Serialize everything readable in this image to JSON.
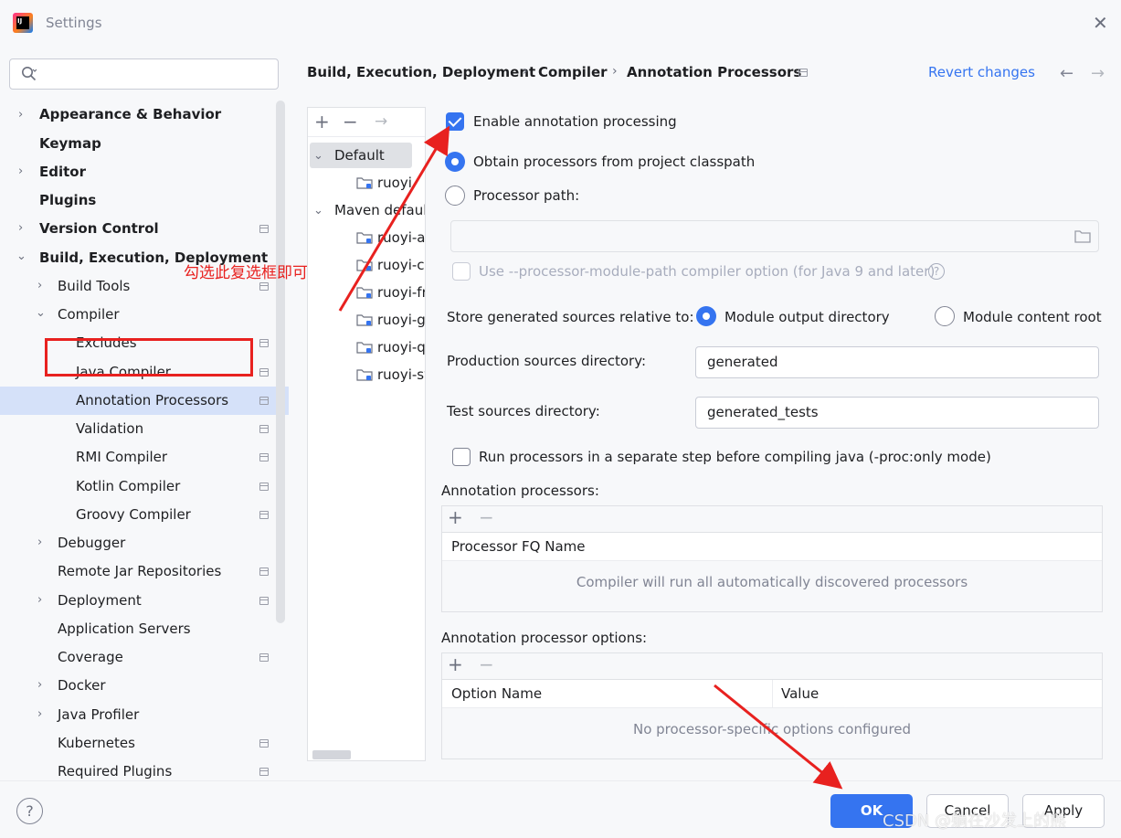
{
  "window": {
    "title": "Settings",
    "logo_text": "IJ"
  },
  "sidebar": {
    "search_placeholder": "",
    "items": [
      {
        "label": "Appearance & Behavior"
      },
      {
        "label": "Keymap"
      },
      {
        "label": "Editor"
      },
      {
        "label": "Plugins"
      },
      {
        "label": "Version Control"
      },
      {
        "label": "Build, Execution, Deployment"
      },
      {
        "label": "Build Tools"
      },
      {
        "label": "Compiler"
      },
      {
        "label": "Excludes"
      },
      {
        "label": "Java Compiler"
      },
      {
        "label": "Annotation Processors"
      },
      {
        "label": "Validation"
      },
      {
        "label": "RMI Compiler"
      },
      {
        "label": "Kotlin Compiler"
      },
      {
        "label": "Groovy Compiler"
      },
      {
        "label": "Debugger"
      },
      {
        "label": "Remote Jar Repositories"
      },
      {
        "label": "Deployment"
      },
      {
        "label": "Application Servers"
      },
      {
        "label": "Coverage"
      },
      {
        "label": "Docker"
      },
      {
        "label": "Java Profiler"
      },
      {
        "label": "Kubernetes"
      },
      {
        "label": "Required Plugins"
      }
    ],
    "selected": "Annotation Processors"
  },
  "annotation_note": "勾选此复选框即可",
  "header": {
    "breadcrumb": [
      "Build, Execution, Deployment",
      "Compiler",
      "Annotation Processors"
    ],
    "revert_label": "Revert changes"
  },
  "profiles": {
    "default_label": "Default",
    "default_children": [
      "ruoyi"
    ],
    "maven_label": "Maven default",
    "maven_children": [
      "ruoyi-admin",
      "ruoyi-common",
      "ruoyi-framework",
      "ruoyi-generator",
      "ruoyi-quartz",
      "ruoyi-system"
    ]
  },
  "form": {
    "enable_label": "Enable annotation processing",
    "enable_checked": true,
    "obtain_label": "Obtain processors from project classpath",
    "processor_path_label": "Processor path:",
    "processor_path_value": "",
    "module_path_label": "Use --processor-module-path compiler option (for Java 9 and later)",
    "store_label": "Store generated sources relative to:",
    "module_output_label": "Module output directory",
    "module_content_label": "Module content root",
    "production_label": "Production sources directory:",
    "production_value": "generated",
    "test_label": "Test sources directory:",
    "test_value": "generated_tests",
    "run_separate_label": "Run processors in a separate step before compiling java (-proc:only mode)",
    "processors_section": "Annotation processors:",
    "processors_col": "Processor FQ Name",
    "processors_empty": "Compiler will run all automatically discovered processors",
    "options_section": "Annotation processor options:",
    "options_col_name": "Option Name",
    "options_col_value": "Value",
    "options_empty": "No processor-specific options configured"
  },
  "footer": {
    "help": "?",
    "ok": "OK",
    "cancel": "Cancel",
    "apply": "Apply"
  },
  "watermark": "CSDN @躺在沙发上的熊",
  "colors": {
    "accent": "#3574f0",
    "annotation_red": "#e8211f",
    "selection": "#d5e1f9"
  }
}
